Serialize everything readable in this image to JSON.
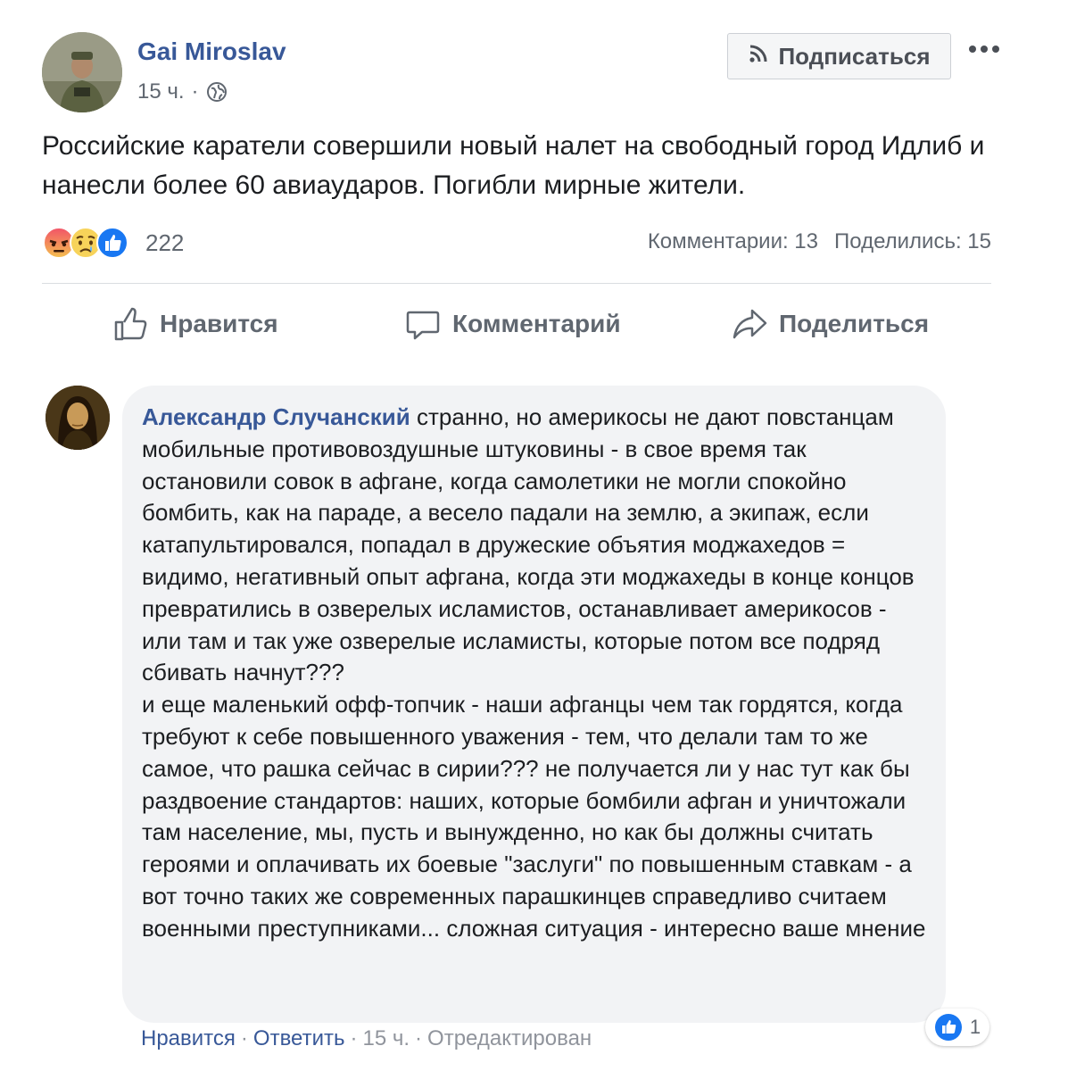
{
  "post": {
    "author": "Gai Miroslav",
    "time": "15 ч.",
    "separator": "·",
    "follow_label": "Подписаться",
    "text": "Российские каратели совершили новый налет на свободный город Идлиб и нанесли более 60 авиаударов. Погибли мирные жители.",
    "reactions": {
      "icons": [
        "angry-icon",
        "sad-icon",
        "like-icon"
      ],
      "count": "222"
    },
    "comments_label": "Комментарии: 13",
    "shares_label": "Поделились: 15"
  },
  "actions": {
    "like": "Нравится",
    "comment": "Комментарий",
    "share": "Поделиться"
  },
  "comment": {
    "author": "Александр Случанский",
    "text": "странно, но америкосы не дают повстанцам мобильные противовоздушные штуковины - в свое время так остановили совок в афгане, когда самолетики не могли спокойно бомбить, как на параде, а весело падали на землю, а экипаж, если катапультировался, попадал в дружеские объятия моджахедов = видимо, негативный опыт афгана, когда эти моджахеды в конце концов превратились в озверелых исламистов, останавливает америкосов - или там и так уже озверелые исламисты, которые потом все подряд сбивать начнут???\nи еще маленький офф-топчик - наши афганцы чем так гордятся, когда требуют к себе повышенного уважения - тем, что делали там то же самое, что рашка сейчас в сирии??? не получается ли у нас тут как бы раздвоение стандартов: наших, которые бомбили афган и уничтожали там население, мы, пусть и вынужденно, но как бы должны считать героями и оплачивать их боевые \"заслуги\" по повышенным ставкам - а вот точно таких же современных парашкинцев справедливо считаем военными преступниками... сложная ситуация - интересно ваше мнение",
    "like_count": "1",
    "like_link": "Нравится",
    "reply_link": "Ответить",
    "time": "15 ч.",
    "edited": "Отредактирован",
    "separator": "·"
  },
  "colors": {
    "link": "#385898",
    "secondary_text": "#606770",
    "bubble_bg": "#f2f3f5",
    "like_blue": "#1877f2"
  }
}
